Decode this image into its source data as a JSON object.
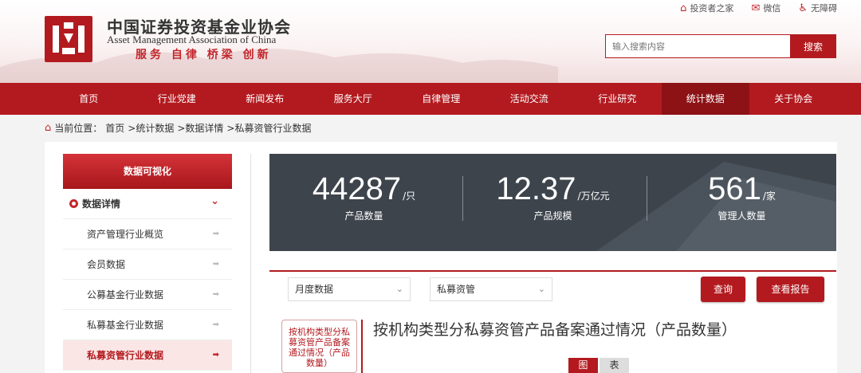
{
  "header": {
    "org_name_cn": "中国证券投资基金业协会",
    "org_name_en": "Asset Management Association of China",
    "slogan": "服务 自律 桥梁 创新",
    "top_links": [
      {
        "label": "投资者之家",
        "icon": "house-icon"
      },
      {
        "label": "微信",
        "icon": "wechat-icon"
      },
      {
        "label": "无障碍",
        "icon": "accessibility-icon"
      }
    ],
    "search": {
      "placeholder": "输入搜索内容",
      "button_label": "搜索"
    },
    "colors": {
      "brand_red": "#b31a1f",
      "nav_active": "#8c1216"
    }
  },
  "nav": {
    "items": [
      "首页",
      "行业党建",
      "新闻发布",
      "服务大厅",
      "自律管理",
      "活动交流",
      "行业研究",
      "统计数据",
      "关于协会"
    ],
    "active": "统计数据"
  },
  "breadcrumb": {
    "prefix": "当前位置：",
    "items": [
      "首页",
      ">统计数据",
      ">数据详情",
      ">私募资管行业数据"
    ]
  },
  "sidebar": {
    "header": "数据可视化",
    "section": "数据详情",
    "items": [
      "资产管理行业概览",
      "会员数据",
      "公募基金行业数据",
      "私募基金行业数据",
      "私募资管行业数据"
    ],
    "active_index": 4
  },
  "stats": [
    {
      "value": "44287",
      "unit": "/只",
      "label": "产品数量"
    },
    {
      "value": "12.37",
      "unit": "/万亿元",
      "label": "产品规模"
    },
    {
      "value": "561",
      "unit": "/家",
      "label": "管理人数量"
    }
  ],
  "filters": {
    "period_select": "月度数据",
    "category_select": "私募资管",
    "query_button": "查询",
    "report_button": "查看报告"
  },
  "chart_section": {
    "tag_label": "按机构类型分私募资管产品备案通过情况（产品数量）",
    "title": "按机构类型分私募资管产品备案通过情况（产品数量）",
    "view_toggle": {
      "chart": "图",
      "table": "表",
      "selected": "图"
    }
  }
}
